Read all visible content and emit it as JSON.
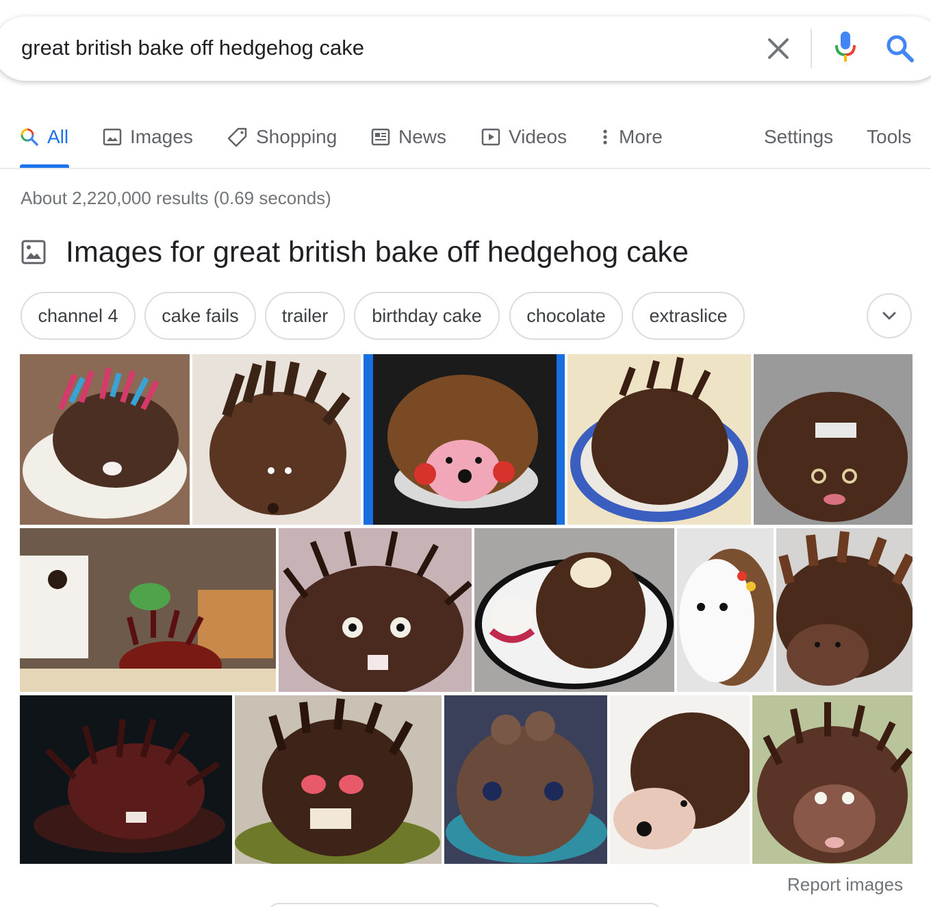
{
  "search": {
    "query": "great british bake off hedgehog cake"
  },
  "tabs": [
    {
      "label": "All",
      "icon": "search-icon",
      "active": true
    },
    {
      "label": "Images",
      "icon": "image-icon"
    },
    {
      "label": "Shopping",
      "icon": "tag-icon"
    },
    {
      "label": "News",
      "icon": "newspaper-icon"
    },
    {
      "label": "Videos",
      "icon": "play-icon"
    },
    {
      "label": "More",
      "icon": "more-vert-icon"
    },
    {
      "label": "Settings"
    },
    {
      "label": "Tools"
    }
  ],
  "result_stats": "About 2,220,000 results (0.69 seconds)",
  "images_section": {
    "title": "Images for great british bake off hedgehog cake",
    "chips": [
      "channel 4",
      "cake fails",
      "trailer",
      "birthday cake",
      "chocolate",
      "extraslice"
    ],
    "report_label": "Report images"
  },
  "colors": {
    "accent_blue": "#1a73e8",
    "text_secondary": "#70757a",
    "chocolate_dark": "#3b2416",
    "chocolate_mid": "#5a3622"
  }
}
